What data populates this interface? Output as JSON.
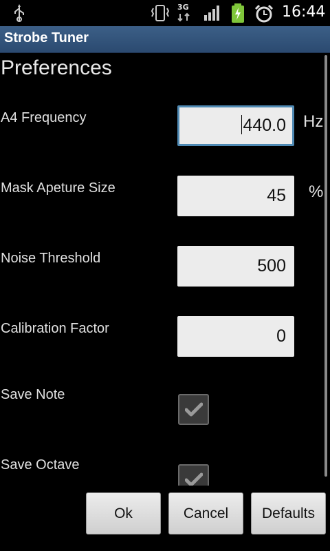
{
  "status_bar": {
    "time": "16:44",
    "network_label": "3G",
    "icons": [
      "usb-icon",
      "vibrate-icon",
      "network-3g-icon",
      "signal-icon",
      "battery-charging-icon",
      "alarm-icon"
    ]
  },
  "title_bar": {
    "title": "Strobe Tuner"
  },
  "heading": "Preferences",
  "preferences": [
    {
      "label": "A4 Frequency",
      "value": "440.0",
      "unit": "Hz",
      "focused": true
    },
    {
      "label": "Mask Apeture Size",
      "value": "45",
      "unit": "%"
    },
    {
      "label": "Noise Threshold",
      "value": "500"
    },
    {
      "label": "Calibration Factor",
      "value": "0"
    },
    {
      "label": "Save Note",
      "checked": true
    },
    {
      "label": "Save Octave",
      "checked": true
    }
  ],
  "buttons": {
    "ok": "Ok",
    "cancel": "Cancel",
    "defaults": "Defaults"
  },
  "colors": {
    "title_bar": "#34557c",
    "field_bg": "#ececec",
    "focus_border": "#4f8ab4"
  }
}
